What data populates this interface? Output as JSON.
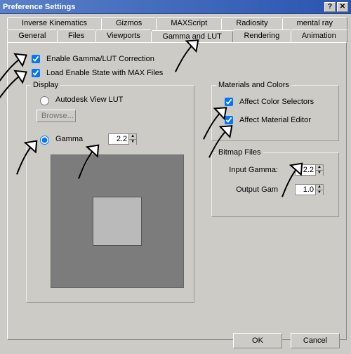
{
  "window": {
    "title": "Preference Settings",
    "help_btn": "?",
    "close_btn": "✕"
  },
  "tabs_top": [
    "Inverse Kinematics",
    "Gizmos",
    "MAXScript",
    "Radiosity",
    "mental ray"
  ],
  "tabs_bottom": [
    "General",
    "Files",
    "Viewports",
    "Gamma and LUT",
    "Rendering",
    "Animation"
  ],
  "chk_enable": "Enable Gamma/LUT Correction",
  "chk_load_state": "Load Enable State with MAX Files",
  "display_group": {
    "legend": "Display",
    "radio_lut": "Autodesk View LUT",
    "browse": "Browse...",
    "radio_gamma": "Gamma",
    "gamma_value": "2.2"
  },
  "matcol_group": {
    "legend": "Materials and Colors",
    "chk_selectors": "Affect Color Selectors",
    "chk_editor": "Affect Material Editor"
  },
  "bitmap_group": {
    "legend": "Bitmap Files",
    "input_label": "Input Gamma:",
    "input_value": "2.2",
    "output_label": "Output Gam",
    "output_value": "1.0"
  },
  "footer": {
    "ok": "OK",
    "cancel": "Cancel"
  }
}
